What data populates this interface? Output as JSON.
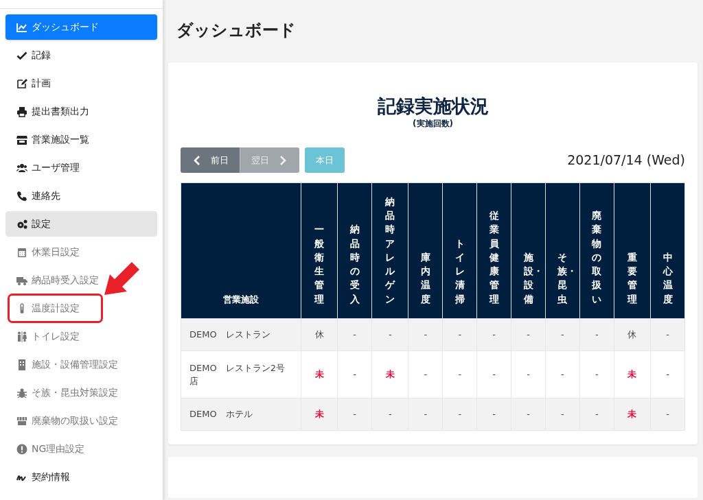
{
  "sidebar": {
    "items": [
      {
        "label": "ダッシュボード",
        "selected": true,
        "expanded": false
      },
      {
        "label": "記録",
        "selected": false,
        "expanded": false
      },
      {
        "label": "計画",
        "selected": false,
        "expanded": false
      },
      {
        "label": "提出書類出力",
        "selected": false,
        "expanded": false
      },
      {
        "label": "営業施設一覧",
        "selected": false,
        "expanded": false
      },
      {
        "label": "ユーザ管理",
        "selected": false,
        "expanded": false
      },
      {
        "label": "連絡先",
        "selected": false,
        "expanded": false
      },
      {
        "label": "設定",
        "selected": false,
        "expanded": true,
        "children": [
          {
            "label": "休業日設定",
            "highlighted": false
          },
          {
            "label": "納品時受入設定",
            "highlighted": false
          },
          {
            "label": "温度計設定",
            "highlighted": true
          },
          {
            "label": "トイレ設定",
            "highlighted": false
          },
          {
            "label": "施設・設備管理設定",
            "highlighted": false
          },
          {
            "label": "そ族・昆虫対策設定",
            "highlighted": false
          },
          {
            "label": "廃棄物の取扱い設定",
            "highlighted": false
          },
          {
            "label": "NG理由設定",
            "highlighted": false
          }
        ]
      },
      {
        "label": "契約情報",
        "selected": false,
        "expanded": false
      }
    ]
  },
  "page_title": "ダッシュボード",
  "card": {
    "title": "記録実施状況",
    "subtitle": "(実施回数)",
    "buttons": [
      {
        "label": "前日",
        "disabled": false,
        "kind": "prev"
      },
      {
        "label": "翌日",
        "disabled": true,
        "kind": "next"
      },
      {
        "label": "本日",
        "disabled": false,
        "kind": "today"
      }
    ],
    "date": "2021/07/14 (Wed)",
    "table": {
      "columns": [
        "営業施設",
        "一般衛生管理",
        "納品時の受入",
        "納品時アレルゲン",
        "庫内温度",
        "トイレ清掃",
        "従業員健康管理",
        "施設・設備",
        "そ族・昆虫",
        "廃棄物の取扱い",
        "重要管理",
        "中心温度"
      ],
      "rows": [
        {
          "cells": [
            {
              "text": "DEMO　レストラン",
              "kind": "facility"
            },
            {
              "text": "休",
              "kind": "rest"
            },
            {
              "text": "-",
              "kind": "none"
            },
            {
              "text": "-",
              "kind": "none"
            },
            {
              "text": "-",
              "kind": "none"
            },
            {
              "text": "-",
              "kind": "none"
            },
            {
              "text": "-",
              "kind": "none"
            },
            {
              "text": "-",
              "kind": "none"
            },
            {
              "text": "-",
              "kind": "none"
            },
            {
              "text": "-",
              "kind": "none"
            },
            {
              "text": "休",
              "kind": "rest"
            },
            {
              "text": "-",
              "kind": "none"
            }
          ]
        },
        {
          "cells": [
            {
              "text": "DEMO　レストラン2号店",
              "kind": "facility"
            },
            {
              "text": "未",
              "kind": "pending"
            },
            {
              "text": "-",
              "kind": "none"
            },
            {
              "text": "未",
              "kind": "pending"
            },
            {
              "text": "-",
              "kind": "none"
            },
            {
              "text": "-",
              "kind": "none"
            },
            {
              "text": "-",
              "kind": "none"
            },
            {
              "text": "-",
              "kind": "none"
            },
            {
              "text": "-",
              "kind": "none"
            },
            {
              "text": "-",
              "kind": "none"
            },
            {
              "text": "未",
              "kind": "pending"
            },
            {
              "text": "-",
              "kind": "none"
            }
          ]
        },
        {
          "cells": [
            {
              "text": "DEMO　ホテル",
              "kind": "facility"
            },
            {
              "text": "未",
              "kind": "pending"
            },
            {
              "text": "-",
              "kind": "none"
            },
            {
              "text": "-",
              "kind": "none"
            },
            {
              "text": "-",
              "kind": "none"
            },
            {
              "text": "-",
              "kind": "none"
            },
            {
              "text": "-",
              "kind": "none"
            },
            {
              "text": "-",
              "kind": "none"
            },
            {
              "text": "-",
              "kind": "none"
            },
            {
              "text": "-",
              "kind": "none"
            },
            {
              "text": "未",
              "kind": "pending"
            },
            {
              "text": "-",
              "kind": "none"
            }
          ]
        }
      ]
    }
  }
}
